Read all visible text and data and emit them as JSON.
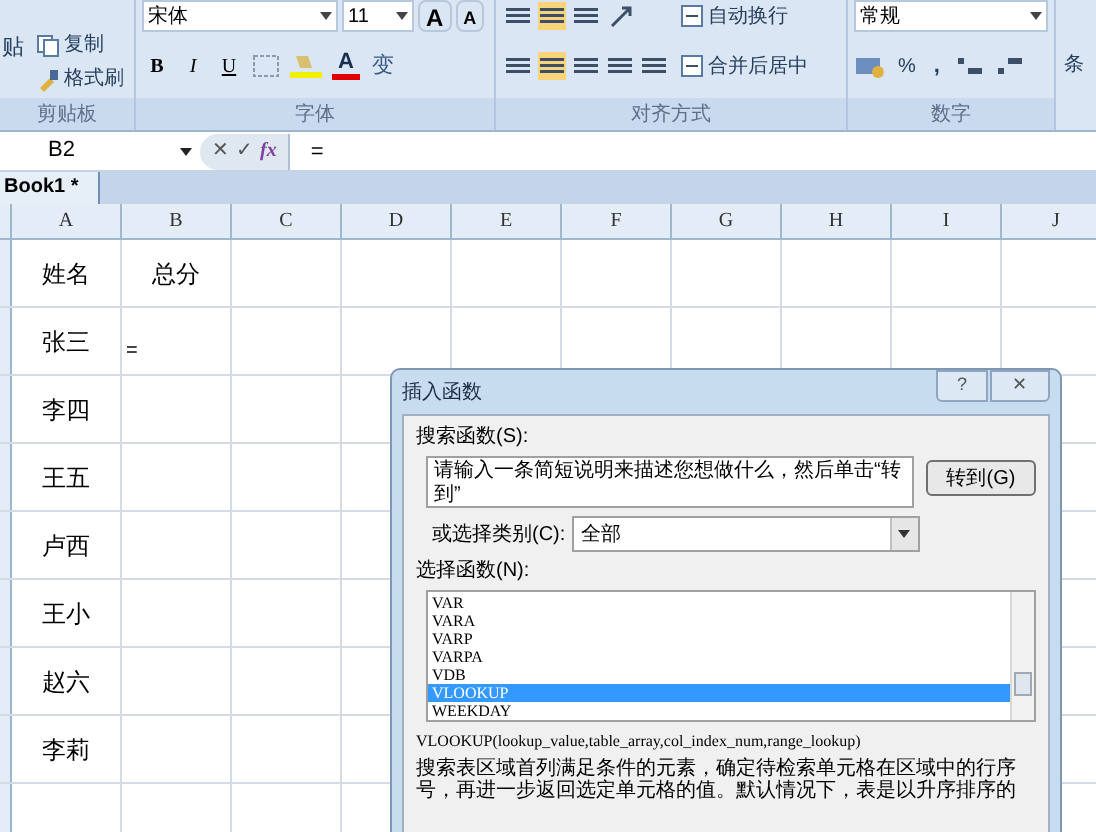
{
  "ribbon": {
    "clipboard": {
      "label": "剪贴板",
      "paste": "贴",
      "buttons": [
        "复制",
        "格式刷"
      ]
    },
    "font": {
      "label": "字体",
      "family": "宋体",
      "size": "11",
      "grow": "A",
      "shrink": "A",
      "style_buttons": [
        "B",
        "I",
        "U"
      ],
      "color_button": "A",
      "phonetic": "变"
    },
    "alignment": {
      "label": "对齐方式",
      "wrap": "自动换行",
      "merge": "合并后居中"
    },
    "number": {
      "label": "数字",
      "format": "常规",
      "percent": "%",
      "comma": ","
    },
    "styles": {
      "label_part": "条"
    }
  },
  "formula_bar": {
    "name_box": "B2",
    "cancel": "✕",
    "enter": "✓",
    "function": "fx",
    "formula": "="
  },
  "workbook_tab": {
    "title": "Book1 *"
  },
  "sheet": {
    "columns": [
      "A",
      "B",
      "C",
      "D",
      "E",
      "F",
      "G",
      "H",
      "I",
      "J"
    ],
    "rows": [
      [
        "姓名",
        "总分"
      ],
      [
        "张三",
        "="
      ],
      [
        "李四",
        ""
      ],
      [
        "王五",
        ""
      ],
      [
        "卢西",
        ""
      ],
      [
        "王小",
        ""
      ],
      [
        "赵六",
        ""
      ],
      [
        "李莉",
        ""
      ],
      [
        "",
        ""
      ]
    ]
  },
  "dialog": {
    "title": "插入函数",
    "help": "?",
    "close": "✕",
    "search_label": "搜索函数(S):",
    "search_text": "请输入一条简短说明来描述您想做什么，然后单击“转到”",
    "go_button": "转到(G)",
    "category_label": "或选择类别(C):",
    "category_value": "全部",
    "list_label": "选择函数(N):",
    "functions": [
      {
        "name": "VAR",
        "selected": false
      },
      {
        "name": "VARA",
        "selected": false
      },
      {
        "name": "VARP",
        "selected": false
      },
      {
        "name": "VARPA",
        "selected": false
      },
      {
        "name": "VDB",
        "selected": false
      },
      {
        "name": "VLOOKUP",
        "selected": true
      },
      {
        "name": "WEEKDAY",
        "selected": false
      }
    ],
    "signature": "VLOOKUP(lookup_value,table_array,col_index_num,range_lookup)",
    "description": "搜索表区域首列满足条件的元素，确定待检索单元格在区域中的行序号，再进一步返回选定单元格的值。默认情况下，表是以升序排序的"
  }
}
